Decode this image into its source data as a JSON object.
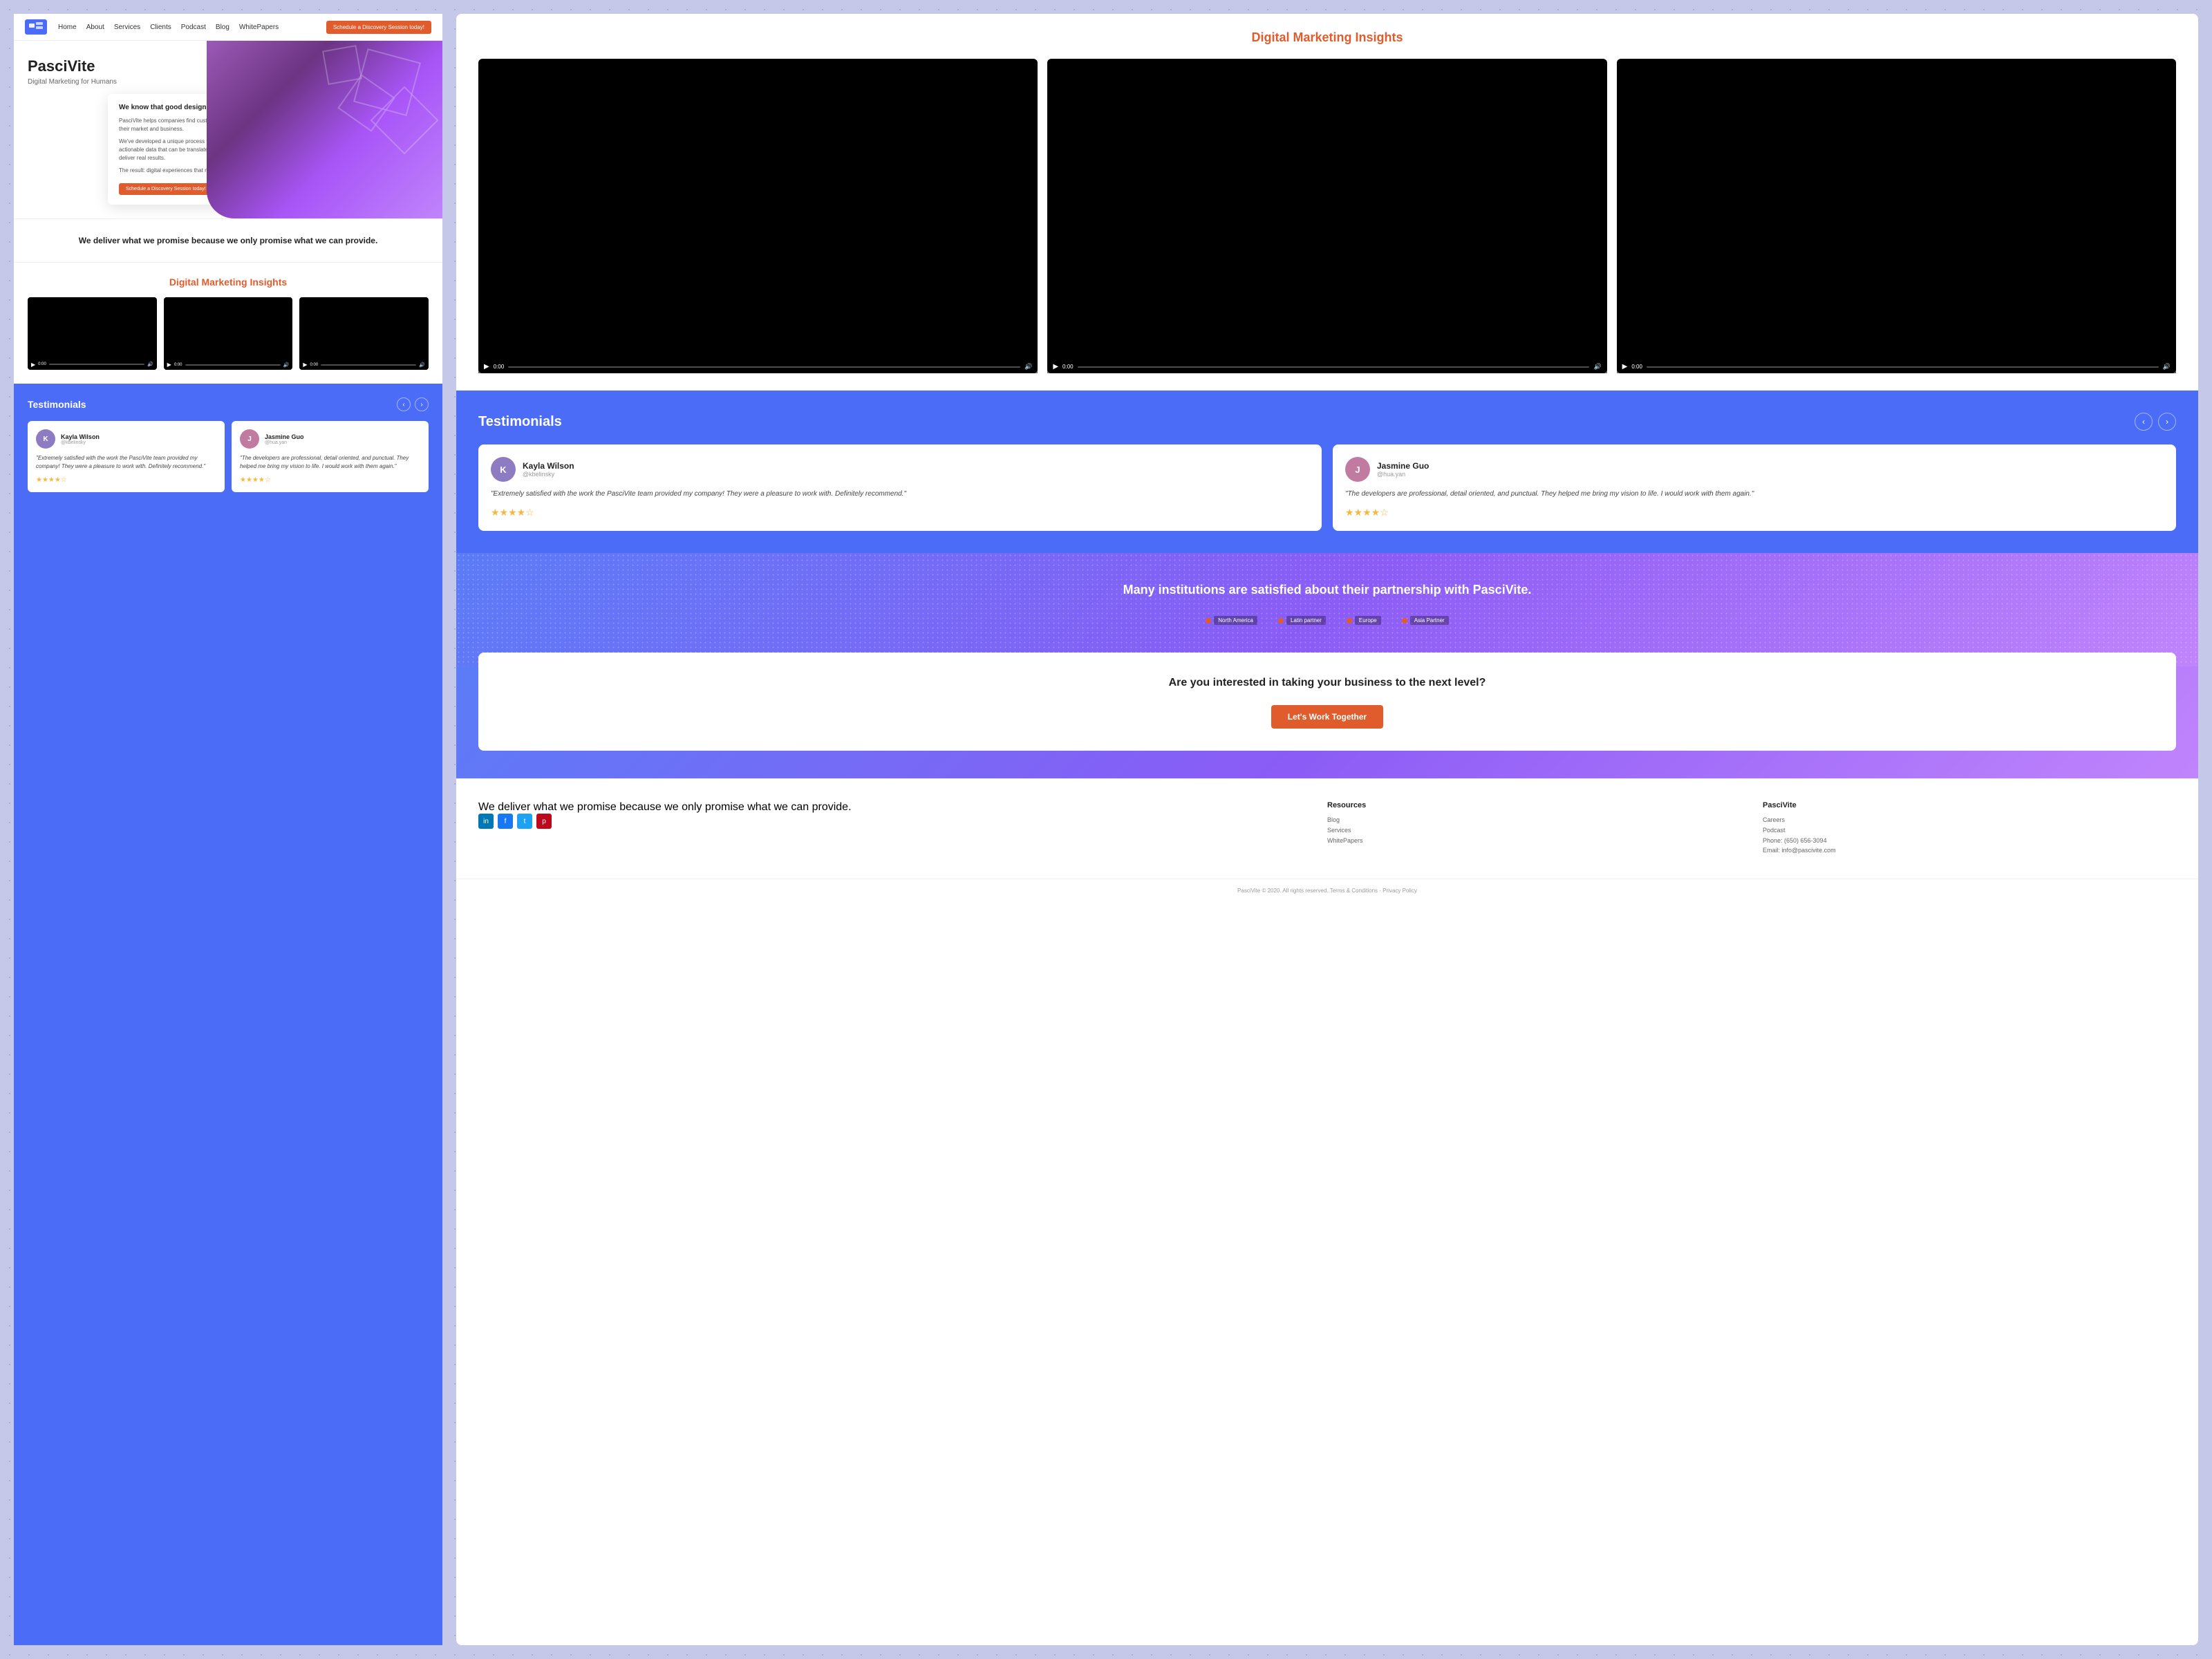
{
  "site": {
    "name": "PasciVite",
    "tagline": "Digital Marketing for Humans",
    "logo_text": "pv"
  },
  "nav": {
    "links": [
      "Home",
      "About",
      "Services",
      "Clients",
      "Podcast",
      "Blog",
      "WhitePapers"
    ],
    "cta": "Schedule a Discovery Session today!"
  },
  "hero": {
    "title": "PasciVite",
    "subtitle": "Digital Marketing for Humans",
    "card_heading": "We know that good design means good business.",
    "card_p1": "PasciVite helps companies find customer insights that will lead to a better understanding of their market and business.",
    "card_p2": "We've developed a unique process that distills thousands of customer experiences into actionable data that can be translated into strategies, tactics, and recommendations that deliver real results.",
    "card_p3": "The result: digital experiences that matter to humans.",
    "card_cta": "Schedule a Discovery Session today!"
  },
  "promise": {
    "text": "We deliver what we promise because we only promise what we can provide."
  },
  "insights": {
    "title": "Digital Marketing Insights",
    "videos": [
      {
        "time": "0:00"
      },
      {
        "time": "0:00"
      },
      {
        "time": "0:00"
      }
    ]
  },
  "testimonials": {
    "title": "Testimonials",
    "items": [
      {
        "name": "Kayla Wilson",
        "role": "@kbelinsky",
        "avatar_letter": "K",
        "text": "\"Extremely satisfied with the work the PasciVite team provided my company! They were a pleasure to work with. Definitely recommend.\"",
        "stars": 4
      },
      {
        "name": "Jasmine Guo",
        "role": "@hua.yan",
        "avatar_letter": "J",
        "text": "\"The developers are professional, detail oriented, and punctual. They helped me bring my vision to life. I would work with them again.\"",
        "stars": 4
      }
    ]
  },
  "map_section": {
    "text": "Many institutions are satisfied about their partnership with PasciVite.",
    "markers": [
      "North America",
      "Latin partner",
      "Europe",
      "Asia Partner"
    ]
  },
  "cta_section": {
    "heading": "Are you interested in taking your business to the next level?",
    "button": "Let's Work Together"
  },
  "footer": {
    "about": "We deliver what we promise because we only promise what we can provide.",
    "social": [
      "in",
      "f",
      "t",
      "p"
    ],
    "resources_title": "Resources",
    "resources": [
      "Blog",
      "Services",
      "WhitePapers"
    ],
    "pascivite_title": "PasciVite",
    "pascivite_links": [
      "Careers",
      "Podcast"
    ],
    "phone": "Phone: (650) 656-3094",
    "email": "Email: info@pascivite.com",
    "copyright": "PasciVite © 2020. All rights reserved. Terms & Conditions · Privacy Policy"
  }
}
